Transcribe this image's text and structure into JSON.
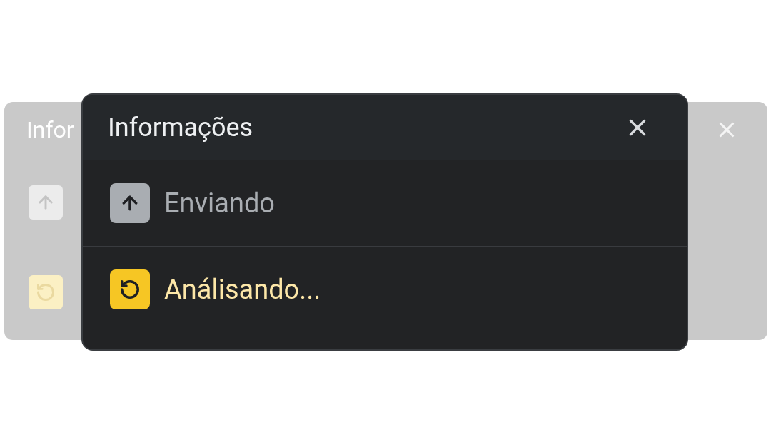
{
  "background_panel": {
    "title": "Infor",
    "items": [
      {
        "kind": "upload"
      },
      {
        "kind": "analyzing"
      }
    ]
  },
  "dialog": {
    "title": "Informações",
    "items": [
      {
        "label": "Enviando",
        "kind": "upload"
      },
      {
        "label": "Análisando...",
        "kind": "analyzing"
      }
    ]
  }
}
